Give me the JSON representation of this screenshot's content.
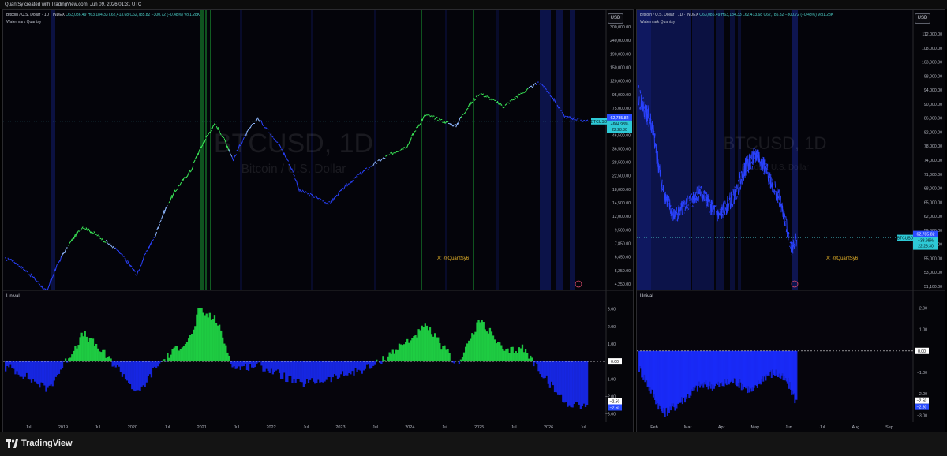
{
  "topbar": {
    "text": "QuantSy created with TradingView.com, Jun 09, 2026 01:31 UTC"
  },
  "colors": {
    "bull": "#22e84a",
    "bear": "#1a2bff",
    "background": "#050509",
    "label_cyan": "#2ec9d6",
    "label_blue": "#2b4dff"
  },
  "left_panel": {
    "symbol": "Bitcoin / U.S. Dollar · 1D · INDEX",
    "ohlc": "O63,086.49 H63,184.33 L62,413.68 C62,785.82 −300.72 (−0.48%) Vol1.28K",
    "subtitle": "Watermark Quantsy",
    "currency": "USD",
    "watermark_main": "BTCUSD, 1D",
    "watermark_sub": "Bitcoin / U.S. Dollar",
    "x_credit": "X: @QuantSy6",
    "price_ticks": [
      "300,000.00",
      "240,000.00",
      "190,000.00",
      "150,000.00",
      "120,000.00",
      "95,000.00",
      "75,000.00",
      "60,000.00",
      "46,500.00",
      "36,500.00",
      "28,500.00",
      "22,500.00",
      "18,000.00",
      "14,500.00",
      "12,000.00",
      "9,500.00",
      "7,850.00",
      "6,450.00",
      "5,250.00",
      "4,250.00"
    ],
    "price_label": {
      "ticker": "BTCUSD",
      "price": "62,785.82",
      "change": "+604.93%",
      "time": "22:28:30"
    },
    "osc_label": "Unival",
    "osc_ticks": [
      "3.00",
      "2.00",
      "1.00",
      "0.00",
      "−1.00",
      "−2.00",
      "−3.00"
    ],
    "osc_labels": {
      "zero": "0.00",
      "a": "−2.50",
      "b": "−2.50"
    },
    "x_ticks": [
      "Jul",
      "2019",
      "Jul",
      "2020",
      "Jul",
      "2021",
      "Jul",
      "2022",
      "Jul",
      "2023",
      "Jul",
      "2024",
      "Jul",
      "2025",
      "Jul",
      "2026",
      "Jul"
    ]
  },
  "right_panel": {
    "symbol": "Bitcoin / U.S. Dollar · 1D · INDEX",
    "ohlc": "O63,086.49 H63,184.33 L62,413.68 C62,785.82 −300.72 (−0.48%) Vol1.28K",
    "subtitle": "Watermark Quantsy",
    "currency": "USD",
    "watermark_main": "BTCUSD, 1D",
    "watermark_sub": "Bitcoin / U.S. Dollar",
    "x_credit": "X: @QuantSy6",
    "price_ticks": [
      "112,000.00",
      "108,000.00",
      "103,000.00",
      "98,000.00",
      "94,000.00",
      "90,000.00",
      "86,000.00",
      "82,000.00",
      "78,000.00",
      "74,000.00",
      "71,000.00",
      "68,000.00",
      "65,000.00",
      "62,000.00",
      "59,000.00",
      "57,000.00",
      "55,000.00",
      "53,000.00",
      "51,100.00"
    ],
    "price_label": {
      "ticker": "BTCUSD",
      "price": "62,785.82",
      "change": "−33.98%",
      "time": "22:28:30"
    },
    "osc_label": "Unival",
    "osc_ticks": [
      "2.00",
      "1.00",
      "0.00",
      "−1.00",
      "−2.00",
      "−3.00"
    ],
    "osc_labels": {
      "zero": "0.00",
      "a": "−2.50",
      "b": "−2.50"
    },
    "x_ticks": [
      "Feb",
      "Mar",
      "Apr",
      "May",
      "Jun",
      "Jul",
      "Aug",
      "Sep"
    ]
  },
  "footer": {
    "brand": "TradingView"
  },
  "chart_data": [
    {
      "type": "line",
      "title": "Bitcoin / U.S. Dollar · 1D · INDEX",
      "scale": "log",
      "ylim": [
        4250,
        300000
      ],
      "series": [
        {
          "name": "BTCUSD",
          "x": [
            "2018-06",
            "2018-12",
            "2019-06",
            "2019-12",
            "2020-03",
            "2020-06",
            "2020-12",
            "2021-04",
            "2021-07",
            "2021-11",
            "2022-06",
            "2022-11",
            "2023-06",
            "2023-12",
            "2024-03",
            "2024-08",
            "2024-12",
            "2025-04",
            "2025-10",
            "2026-02",
            "2026-06"
          ],
          "values": [
            6400,
            3700,
            11000,
            7200,
            4900,
            9400,
            28000,
            60000,
            33000,
            66000,
            20000,
            16000,
            30000,
            42000,
            70000,
            58000,
            100000,
            80000,
            120000,
            68000,
            62785.82
          ]
        }
      ],
      "last_price": 62785.82
    },
    {
      "type": "area",
      "title": "Unival",
      "ylim": [
        -3.2,
        3.3
      ],
      "series": [
        {
          "name": "Unival",
          "x": [
            "2018-06",
            "2018-12",
            "2019-06",
            "2019-12",
            "2020-03",
            "2020-06",
            "2020-12",
            "2021-01",
            "2021-04",
            "2021-07",
            "2021-11",
            "2022-06",
            "2022-11",
            "2023-06",
            "2023-12",
            "2024-03",
            "2024-08",
            "2024-12",
            "2025-04",
            "2025-07",
            "2025-10",
            "2026-02",
            "2026-06"
          ],
          "values": [
            -0.4,
            -1.6,
            1.6,
            -0.5,
            -1.9,
            -0.3,
            1.5,
            2.9,
            2.4,
            -0.4,
            -0.2,
            -1.3,
            -1.0,
            -0.3,
            1.2,
            2.0,
            -0.2,
            2.4,
            0.5,
            0.8,
            -0.6,
            -2.4,
            -2.5
          ]
        }
      ],
      "reference_line": 0
    },
    {
      "type": "line",
      "title": "Bitcoin / U.S. Dollar · 1D · INDEX",
      "ylim": [
        51100,
        112000
      ],
      "series": [
        {
          "name": "BTCUSD",
          "x": [
            "2026-01-20",
            "2026-02-01",
            "2026-02-10",
            "2026-02-20",
            "2026-03-01",
            "2026-03-15",
            "2026-04-01",
            "2026-04-15",
            "2026-04-25",
            "2026-05-05",
            "2026-05-15",
            "2026-05-25",
            "2026-06-05",
            "2026-06-09"
          ],
          "values": [
            97000,
            90000,
            75000,
            68000,
            70000,
            74000,
            68000,
            73000,
            80000,
            83000,
            78000,
            72000,
            60000,
            62785.82
          ]
        }
      ]
    },
    {
      "type": "area",
      "title": "Unival",
      "ylim": [
        -3.1,
        2.2
      ],
      "series": [
        {
          "name": "Unival",
          "x": [
            "2026-01-20",
            "2026-02-01",
            "2026-02-10",
            "2026-02-20",
            "2026-03-01",
            "2026-03-15",
            "2026-04-01",
            "2026-04-15",
            "2026-05-01",
            "2026-05-10",
            "2026-05-20",
            "2026-06-01",
            "2026-06-09"
          ],
          "values": [
            -0.8,
            -2.0,
            -2.9,
            -2.6,
            -2.2,
            -1.6,
            -1.6,
            -1.4,
            -1.9,
            -1.2,
            -1.0,
            -1.5,
            -2.5
          ]
        }
      ],
      "reference_line": 0
    }
  ]
}
